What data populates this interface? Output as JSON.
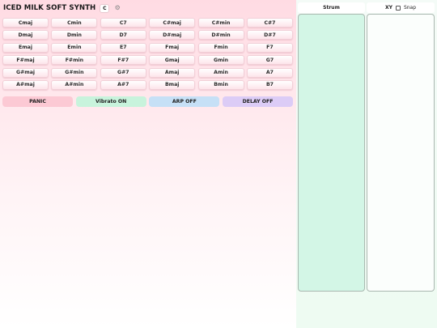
{
  "header": {
    "title": "ICED MILK SOFT SYNTH",
    "key": "C",
    "settings_icon": "gear-icon"
  },
  "chords": [
    [
      "Cmaj",
      "Cmin",
      "C7",
      "C#maj",
      "C#min",
      "C#7"
    ],
    [
      "Dmaj",
      "Dmin",
      "D7",
      "D#maj",
      "D#min",
      "D#7"
    ],
    [
      "Emaj",
      "Emin",
      "E7",
      "Fmaj",
      "Fmin",
      "F7"
    ],
    [
      "F#maj",
      "F#min",
      "F#7",
      "Gmaj",
      "Gmin",
      "G7"
    ],
    [
      "G#maj",
      "G#min",
      "G#7",
      "Amaj",
      "Amin",
      "A7"
    ],
    [
      "A#maj",
      "A#min",
      "A#7",
      "Bmaj",
      "Bmin",
      "B7"
    ]
  ],
  "controls": {
    "panic": "PANIC",
    "vibrato": "Vibrato ON",
    "arp": "ARP OFF",
    "delay": "DELAY OFF"
  },
  "strum": {
    "label": "Strum"
  },
  "xy": {
    "label": "XY",
    "snap_label": "Snap",
    "snap_checked": false
  },
  "colors": {
    "background_top": "#ffdbe3",
    "chord_button": "#fde4ea",
    "panic": "#fcc9d4",
    "vibrato": "#c8f3dc",
    "arp": "#c6e0f6",
    "delay": "#dcccf6",
    "strum_pad": "#d3f6e6",
    "xy_pad": "#fbfefc"
  }
}
